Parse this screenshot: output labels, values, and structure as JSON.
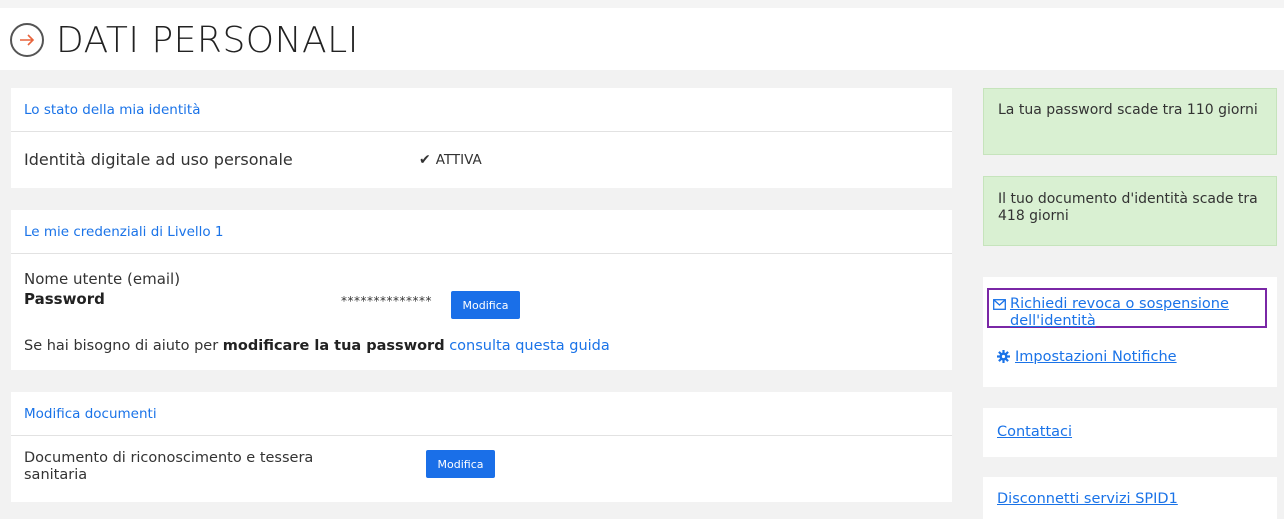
{
  "header": {
    "title": "DATI PERSONALI"
  },
  "identity_card": {
    "title": "Lo stato della mia identità",
    "label": "Identità digitale ad uso personale",
    "status": "ATTIVA"
  },
  "credentials_card": {
    "title": "Le mie credenziali di Livello 1",
    "username_label": "Nome utente (email)",
    "password_label": "Password",
    "password_mask": "**************",
    "modify_button": "Modifica",
    "help_prefix": "Se hai bisogno di aiuto per ",
    "help_bold": "modificare la tua password",
    "help_link": "consulta questa guida"
  },
  "documents_card": {
    "title": "Modifica documenti",
    "label": "Documento di riconoscimento e tessera sanitaria",
    "modify_button": "Modifica"
  },
  "sidebar": {
    "password_alert": "La tua password scade tra 110 giorni",
    "document_alert": "Il tuo documento d'identità scade tra 418 giorni",
    "revoke_link": "Richiedi revoca o sospensione dell'identità",
    "notifications_link": "Impostazioni Notifiche",
    "contact_link": "Contattaci",
    "disconnect_link": "Disconnetti servizi SPID1"
  },
  "colors": {
    "link": "#1a73e8",
    "button": "#1a6fe8",
    "alert_bg": "#d9f0d2",
    "highlight_border": "#7a27a6"
  }
}
